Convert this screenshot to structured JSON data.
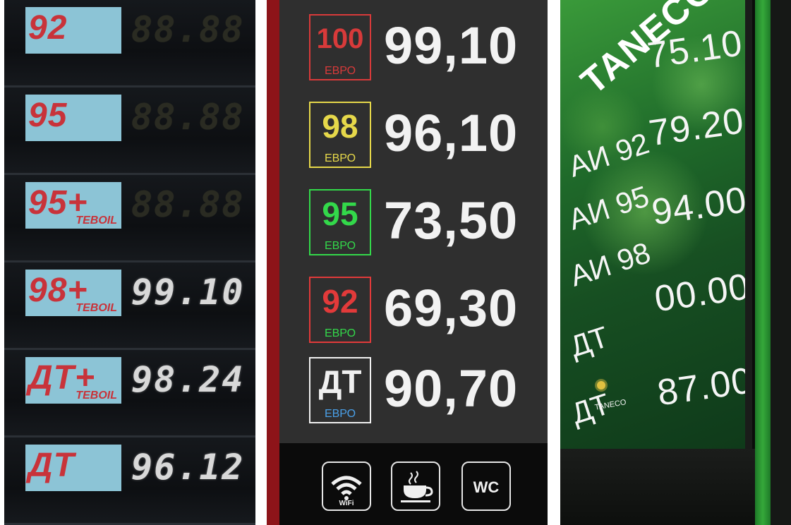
{
  "panel_teboil": {
    "rows": [
      {
        "fuel": "92",
        "sub": "",
        "price": "88.88"
      },
      {
        "fuel": "95",
        "sub": "",
        "price": "88.88"
      },
      {
        "fuel": "95+",
        "sub": "TEBOIL",
        "price": "88.88"
      },
      {
        "fuel": "98+",
        "sub": "TEBOIL",
        "price": "99.10"
      },
      {
        "fuel": "ДТ+",
        "sub": "TEBOIL",
        "price": "98.24"
      },
      {
        "fuel": "ДТ",
        "sub": "",
        "price": "96.12"
      }
    ],
    "colors": {
      "label_bg": "#8cc4d6",
      "label_text": "#c8333a",
      "digit_lit": "#d8d8d8",
      "digit_dim": "#2a2b22"
    }
  },
  "panel_led": {
    "rows": [
      {
        "fuel": "100",
        "evro": "ЕВРО",
        "price": "99,10",
        "color": "#d83a3a"
      },
      {
        "fuel": "98",
        "evro": "ЕВРО",
        "price": "96,10",
        "color": "#e6d84a"
      },
      {
        "fuel": "95",
        "evro": "ЕВРО",
        "price": "73,50",
        "color": "#33d84a"
      },
      {
        "fuel": "92",
        "evro": "ЕВРО",
        "price": "69,30",
        "color": "#e23a3a"
      },
      {
        "fuel": "ДТ",
        "evro": "ЕВРО",
        "price": "90,70",
        "color": "#f0f0f0"
      }
    ],
    "icons": [
      {
        "name": "wifi-icon",
        "label": "WiFi"
      },
      {
        "name": "coffee-cup-icon",
        "label": ""
      },
      {
        "name": "wc-icon",
        "label": "WC"
      }
    ]
  },
  "panel_taneco": {
    "brand": "TANECO",
    "rows": [
      {
        "fuel": "АИ 92",
        "price": "75.10"
      },
      {
        "fuel": "АИ 95",
        "price": "79.20"
      },
      {
        "fuel": "АИ 98",
        "price": "94.00"
      },
      {
        "fuel": "ДТ",
        "price": "00.00"
      },
      {
        "fuel": "ДТ",
        "price": "87.00",
        "sub": "TANECO"
      }
    ]
  }
}
